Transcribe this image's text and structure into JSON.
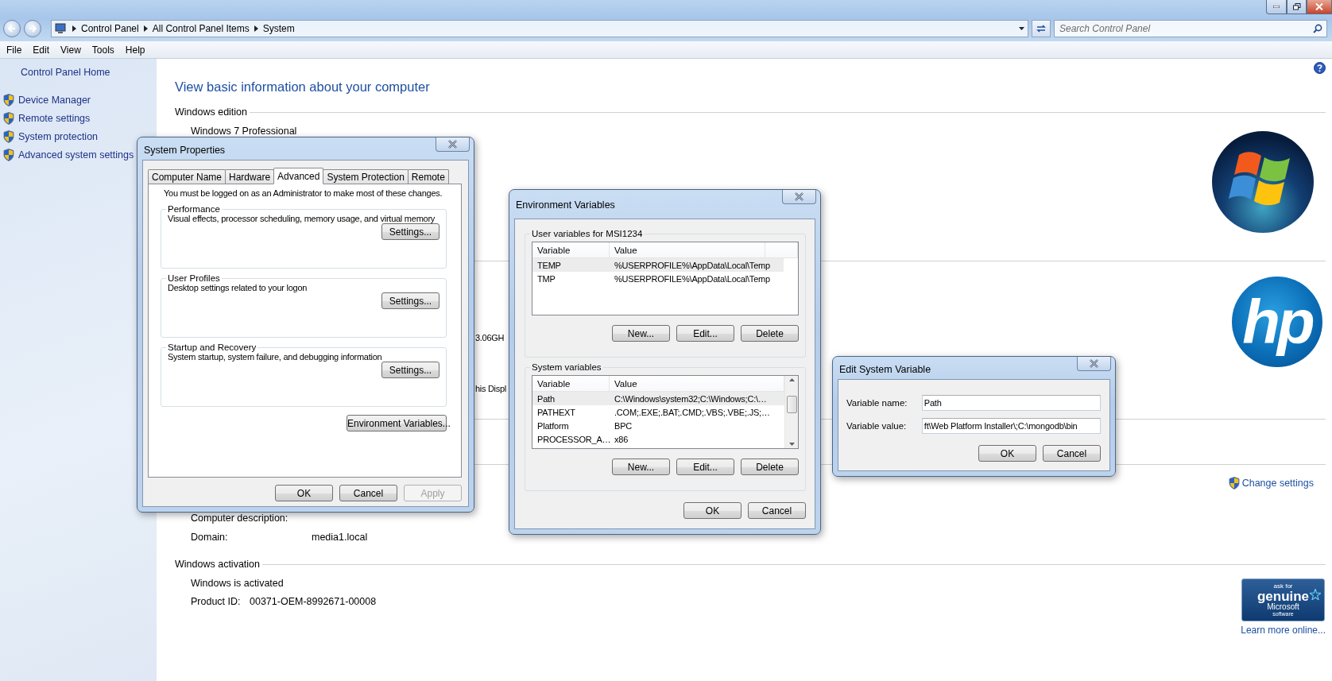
{
  "window": {
    "breadcrumb": [
      "Control Panel",
      "All Control Panel Items",
      "System"
    ],
    "search": {
      "placeholder": "Search Control Panel"
    }
  },
  "menu": [
    "File",
    "Edit",
    "View",
    "Tools",
    "Help"
  ],
  "sidebar": {
    "home": "Control Panel Home",
    "items": [
      {
        "label": "Device Manager"
      },
      {
        "label": "Remote settings"
      },
      {
        "label": "System protection"
      },
      {
        "label": "Advanced system settings"
      }
    ]
  },
  "main": {
    "heading": "View basic information about your computer",
    "sections": [
      {
        "kind": "edition",
        "title": "Windows edition",
        "lines": [
          "Windows 7 Professional"
        ]
      },
      {
        "kind": "system",
        "fragments": [
          "3.06GH",
          "his Displ"
        ],
        "logo_text": "hp"
      },
      {
        "kind": "blank"
      },
      {
        "kind": "computer",
        "link": "Change settings",
        "rows": [
          {
            "label": "Computer description:"
          },
          {
            "label": "Domain:",
            "value": "media1.local"
          }
        ]
      },
      {
        "kind": "activation",
        "title": "Windows activation",
        "lines": [
          "Windows is activated"
        ],
        "rows": [
          {
            "label": "Product ID:",
            "value": "00371-OEM-8992671-00008"
          }
        ],
        "badge": [
          "ask for",
          "genuine",
          "Microsoft",
          "software"
        ],
        "link": "Learn more online..."
      }
    ]
  },
  "system_properties": {
    "title": "System Properties",
    "tabs": [
      {
        "label": "Computer Name",
        "selected": false
      },
      {
        "label": "Hardware",
        "selected": false
      },
      {
        "label": "Advanced",
        "selected": true
      },
      {
        "label": "System Protection",
        "selected": false
      },
      {
        "label": "Remote",
        "selected": false
      }
    ],
    "notice": "You must be logged on as an Administrator to make most of these changes.",
    "groups": [
      {
        "title": "Performance",
        "text": "Visual effects, processor scheduling, memory usage, and virtual memory",
        "button": "Settings..."
      },
      {
        "title": "User Profiles",
        "text": "Desktop settings related to your logon",
        "button": "Settings..."
      },
      {
        "title": "Startup and Recovery",
        "text": "System startup, system failure, and debugging information",
        "button": "Settings..."
      }
    ],
    "env_button": "Environment Variables...",
    "buttons": [
      {
        "label": "OK",
        "disabled": false
      },
      {
        "label": "Cancel",
        "disabled": false
      },
      {
        "label": "Apply",
        "disabled": true
      }
    ]
  },
  "environment_variables": {
    "title": "Environment Variables",
    "groups": [
      {
        "title": "User variables for MSI1234",
        "columns": [
          "Variable",
          "Value"
        ],
        "scrollbar": false,
        "rows": [
          {
            "variable": "TEMP",
            "value": "%USERPROFILE%\\AppData\\Local\\Temp",
            "selected": true
          },
          {
            "variable": "TMP",
            "value": "%USERPROFILE%\\AppData\\Local\\Temp",
            "selected": false
          }
        ],
        "buttons": [
          "New...",
          "Edit...",
          "Delete"
        ]
      },
      {
        "title": "System variables",
        "columns": [
          "Variable",
          "Value"
        ],
        "scrollbar": true,
        "rows": [
          {
            "variable": "Path",
            "value": "C:\\Windows\\system32;C:\\Windows;C:\\…",
            "selected": true
          },
          {
            "variable": "PATHEXT",
            "value": ".COM;.EXE;.BAT;.CMD;.VBS;.VBE;.JS;…",
            "selected": false
          },
          {
            "variable": "Platform",
            "value": "BPC",
            "selected": false
          },
          {
            "variable": "PROCESSOR_A…",
            "value": "x86",
            "selected": false
          }
        ],
        "buttons": [
          "New...",
          "Edit...",
          "Delete"
        ]
      }
    ],
    "buttons": [
      "OK",
      "Cancel"
    ]
  },
  "edit_system_variable": {
    "title": "Edit System Variable",
    "fields": [
      {
        "label": "Variable name:",
        "value": "Path"
      },
      {
        "label": "Variable value:",
        "value": "ft\\Web Platform Installer\\;C:\\mongodb\\bin"
      }
    ],
    "buttons": [
      "OK",
      "Cancel"
    ]
  }
}
